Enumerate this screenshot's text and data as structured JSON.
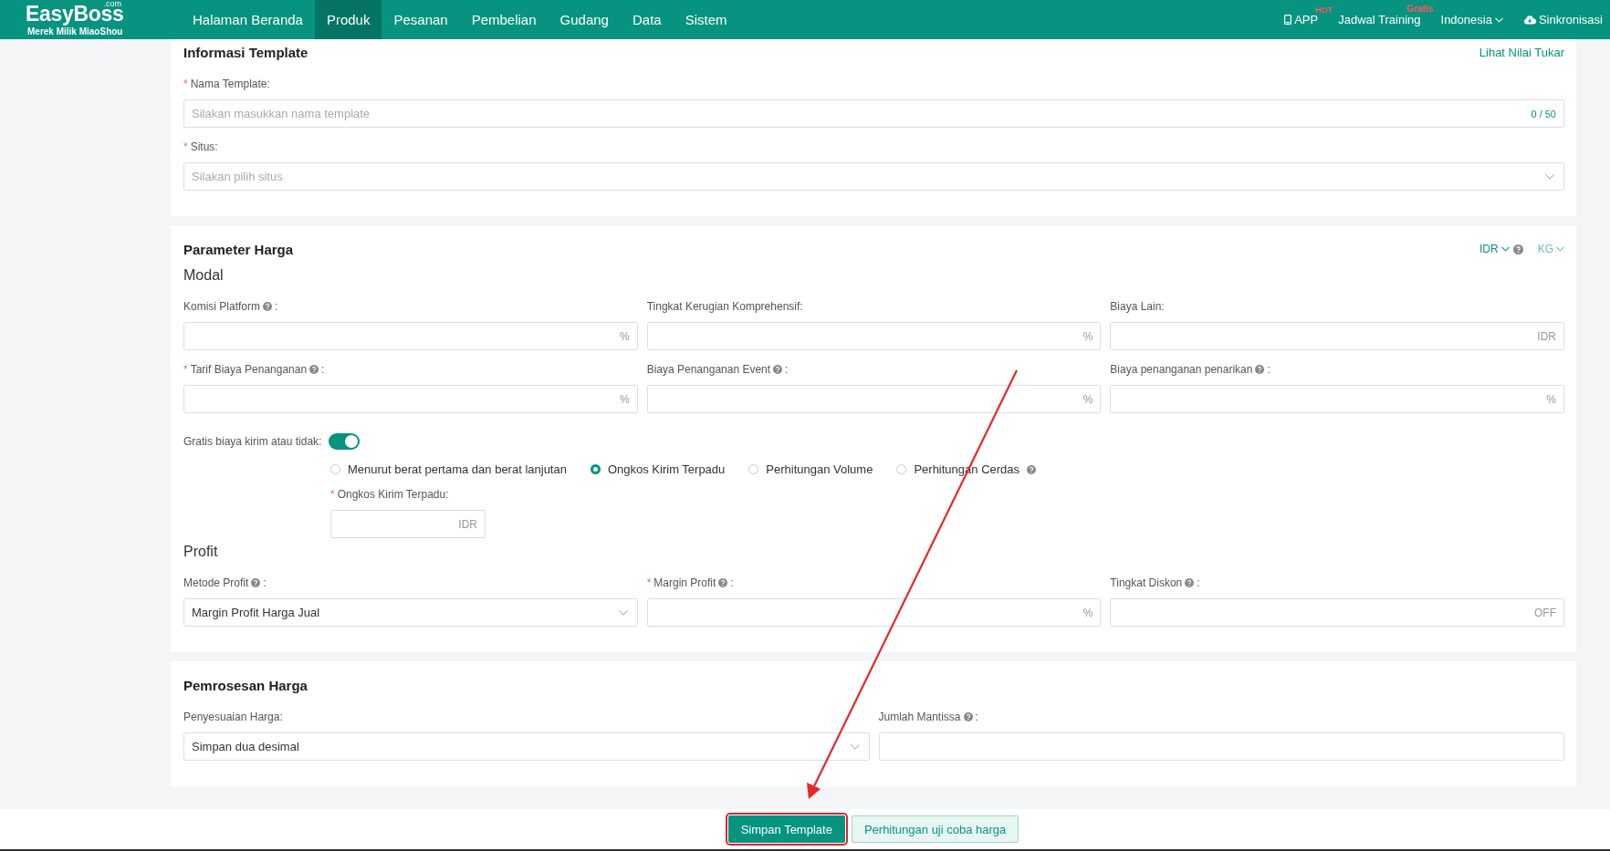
{
  "brand": {
    "name": "EasyBoss",
    "suffix": ".com",
    "tagline": "Merek Milik MiaoShou"
  },
  "nav": [
    {
      "label": "Halaman Beranda",
      "selected": false
    },
    {
      "label": "Produk",
      "selected": true
    },
    {
      "label": "Pesanan",
      "selected": false
    },
    {
      "label": "Pembelian",
      "selected": false
    },
    {
      "label": "Gudang",
      "selected": false
    },
    {
      "label": "Data",
      "selected": false
    },
    {
      "label": "Sistem",
      "selected": false
    }
  ],
  "header_links": [
    {
      "kind": "app",
      "label": "APP",
      "badge": "HOT"
    },
    {
      "kind": "plain",
      "label": "Jadwal Training",
      "badge": "Gratis"
    },
    {
      "kind": "dropdown",
      "label": "Indonesia"
    },
    {
      "kind": "sync",
      "label": "Sinkronisasi"
    }
  ],
  "template_info": {
    "title": "Informasi Template",
    "link": "Lihat Nilai Tukar",
    "fields": [
      {
        "kind": "input",
        "label": "Nama Template:",
        "required_mark": "*",
        "placeholder": "Silakan masukkan nama template",
        "counter": "0 / 50"
      },
      {
        "kind": "select",
        "label": "Situs:",
        "required_mark": "*",
        "placeholder": "Silakan pilih situs"
      }
    ]
  },
  "price_params": {
    "title": "Parameter Harga",
    "currency": "IDR",
    "unit": "KG",
    "modal": {
      "title": "Modal",
      "fields": [
        {
          "kind": "input",
          "label": "Komisi Platform",
          "help": true,
          "label_end": ":",
          "suffix": "%"
        },
        {
          "kind": "input",
          "label": "Tingkat Kerugian Komprehensif:",
          "suffix": "%"
        },
        {
          "kind": "input",
          "label": "Biaya Lain:",
          "suffix": "IDR"
        },
        {
          "kind": "input",
          "label": "Tarif Biaya Penanganan",
          "help": true,
          "label_end": ":",
          "required_mark": "*",
          "suffix": "%"
        },
        {
          "kind": "input",
          "label": "Biaya Penanganan Event",
          "help": true,
          "label_end": ":",
          "suffix": "%"
        },
        {
          "kind": "input",
          "label": "Biaya penanganan penarikan",
          "help": true,
          "label_end": ":",
          "suffix": "%"
        }
      ]
    },
    "free_shipping": {
      "label": "Gratis biaya kirim atau tidak:",
      "on": true
    },
    "shipping_methods": [
      {
        "label": "Menurut berat pertama dan berat lanjutan",
        "selected": false
      },
      {
        "label": "Ongkos Kirim Terpadu",
        "selected": true
      },
      {
        "label": "Perhitungan Volume",
        "selected": false
      },
      {
        "label": "Perhitungan Cerdas",
        "selected": false,
        "help": true
      }
    ],
    "shipping_field": {
      "kind": "input",
      "label": "Ongkos Kirim Terpadu:",
      "required_mark": "*",
      "suffix": "IDR"
    },
    "profit": {
      "title": "Profit",
      "fields": [
        {
          "kind": "select",
          "label": "Metode Profit",
          "help": true,
          "label_end": ":",
          "value": "Margin Profit Harga Jual"
        },
        {
          "kind": "input",
          "label": "Margin Profit",
          "help": true,
          "label_end": ":",
          "required_mark": "*",
          "suffix": "%"
        },
        {
          "kind": "input",
          "label": "Tingkat Diskon",
          "help": true,
          "label_end": ":",
          "suffix": "OFF"
        }
      ]
    }
  },
  "price_processing": {
    "title": "Pemrosesan Harga",
    "fields": [
      {
        "kind": "select",
        "label": "Penyesuaian Harga:",
        "value": "Simpan dua desimal"
      },
      {
        "kind": "input",
        "label": "Jumlah Mantissa",
        "help": true,
        "label_end": ":"
      }
    ]
  },
  "footer_buttons": [
    {
      "label": "Simpan Template",
      "kind": "primary",
      "highlighted": true
    },
    {
      "label": "Perhitungan uji coba harga",
      "kind": "secondary",
      "highlighted": false
    }
  ]
}
